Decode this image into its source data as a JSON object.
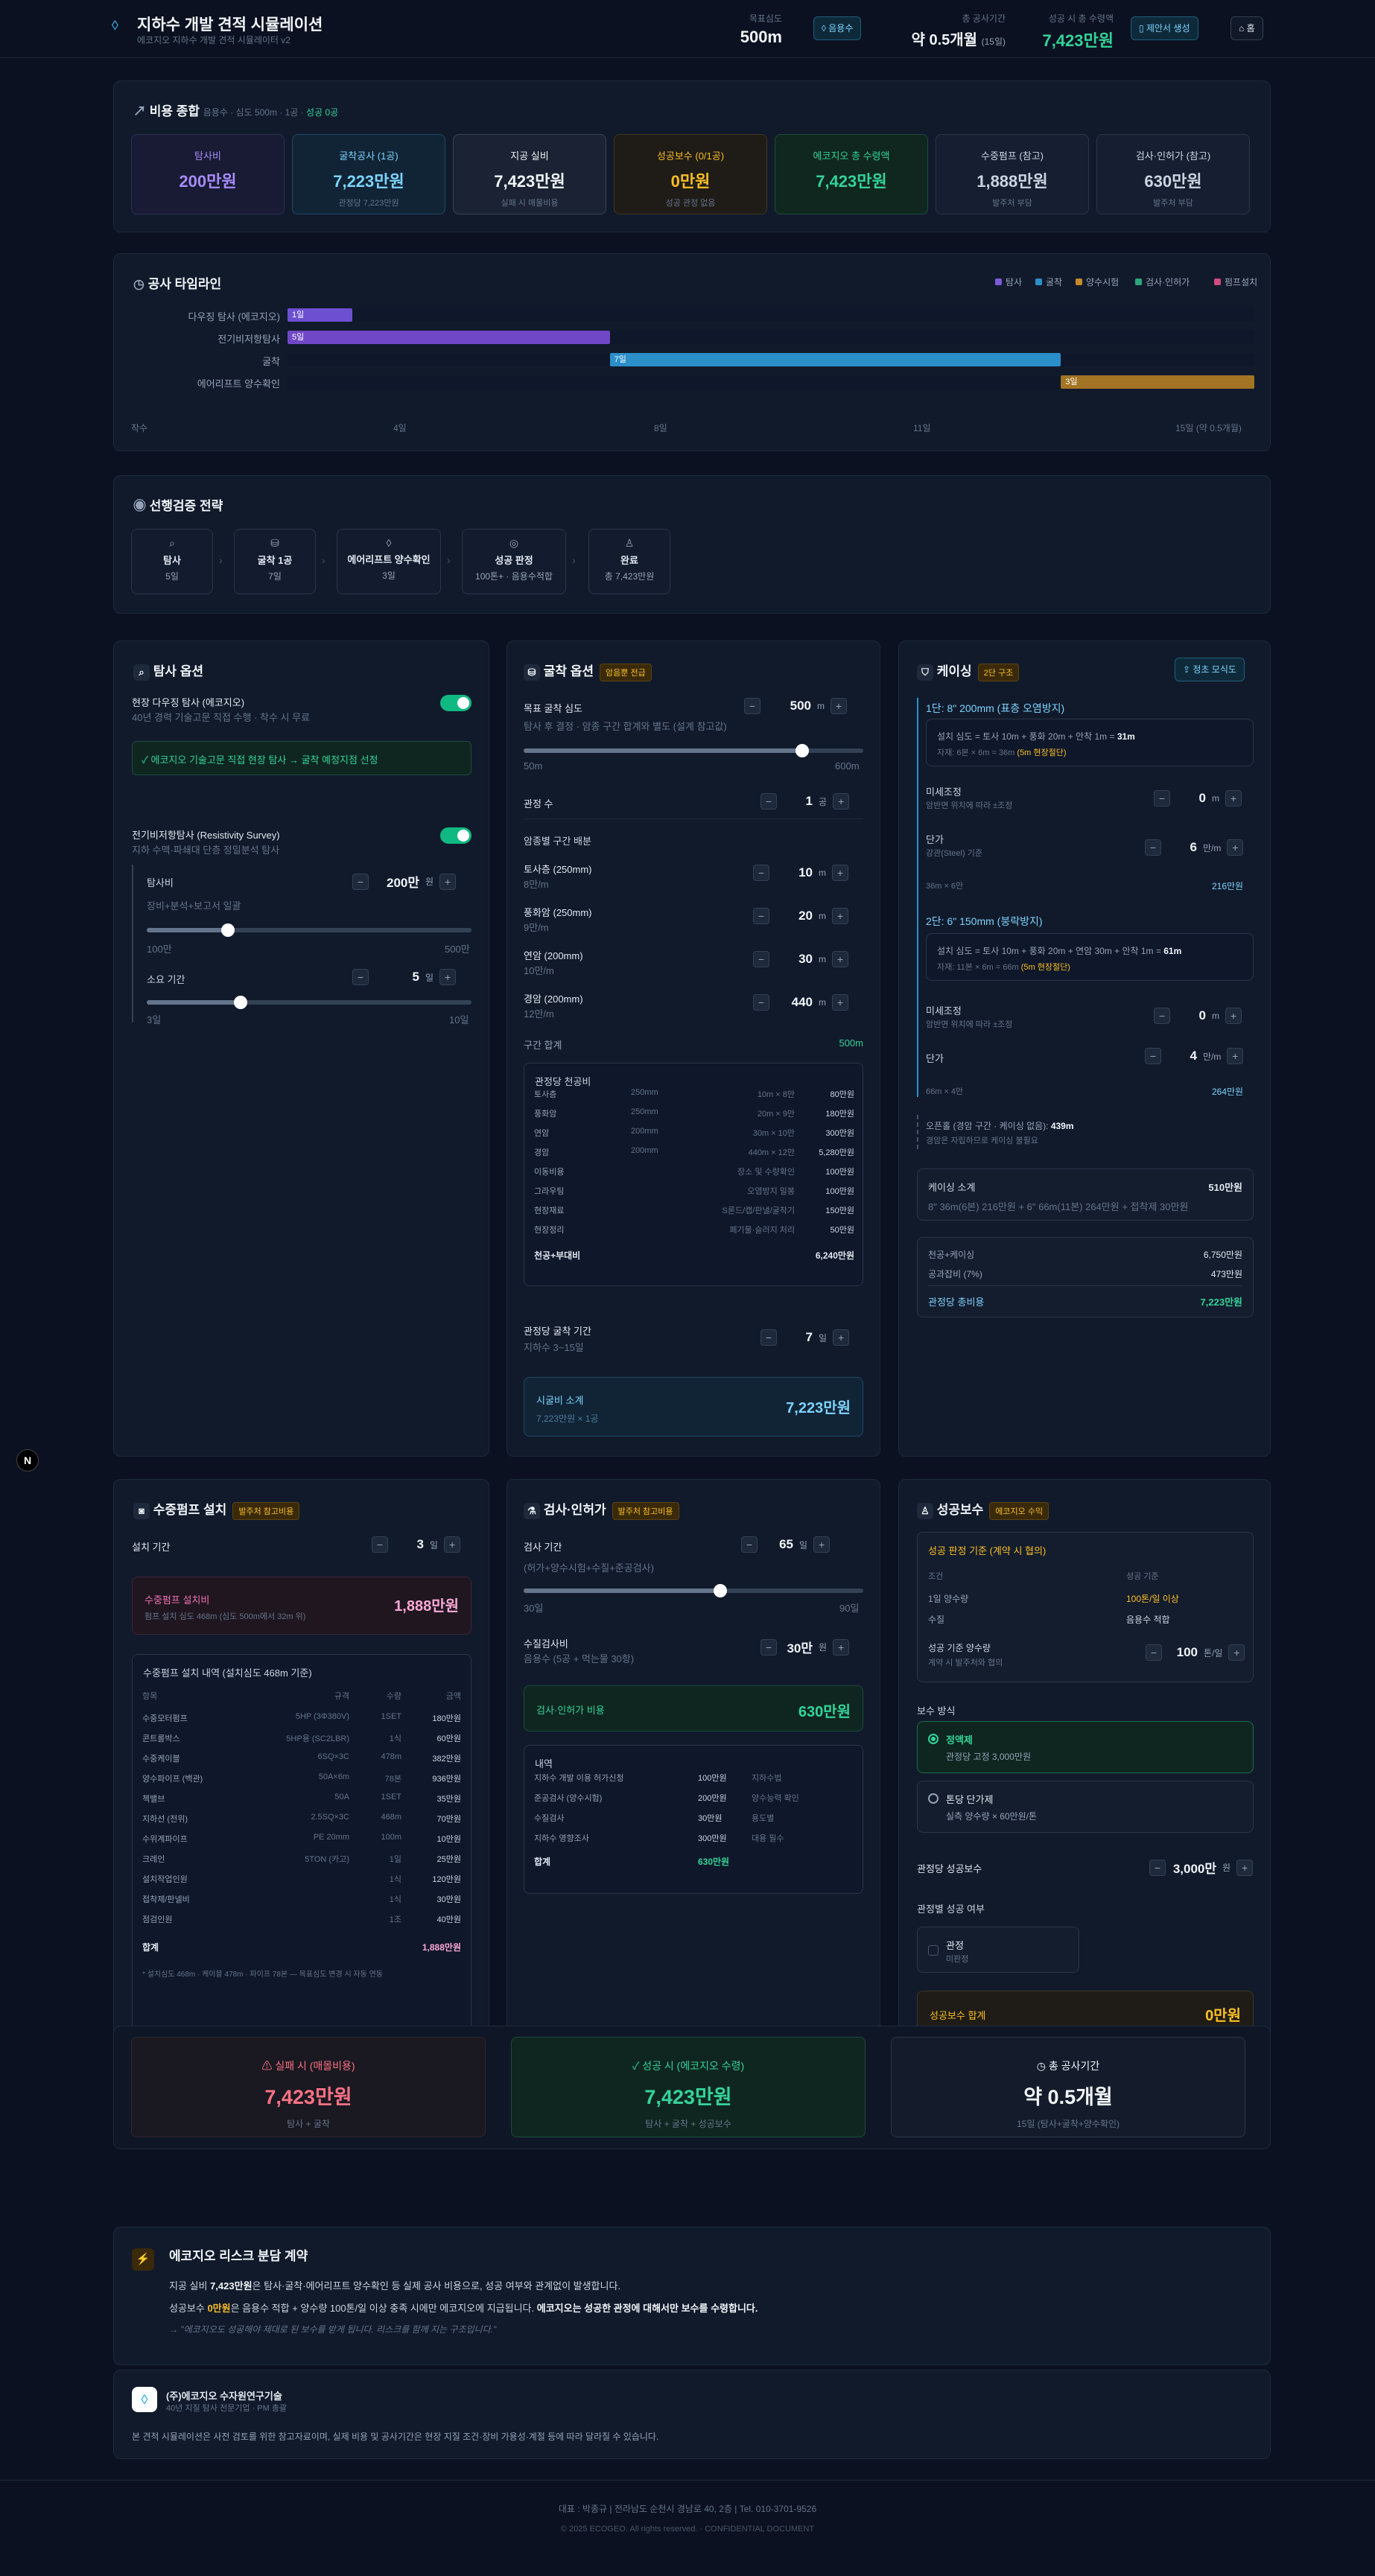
{
  "header": {
    "title": "지하수 개발 견적 시뮬레이션",
    "subtitle": "에코지오 지하수 개발 견적 시뮬레이터 v2",
    "stats": [
      {
        "label": "목표심도",
        "value": "500m"
      },
      {
        "label": "총 공사기간",
        "value": "약 0.5개월",
        "extra": "(15일)"
      },
      {
        "label": "성공 시 총 수령액",
        "value": "7,423만원"
      }
    ],
    "btn_use": "음용수",
    "btn_pdf": "제안서 생성",
    "btn_home": "홈"
  },
  "summary": {
    "title": "비용 종합",
    "meta": "음용수 · 심도 500m · 1공 · ",
    "meta_status": "성공 0공",
    "boxes": [
      {
        "label": "탐사비",
        "value": "200만원",
        "sub": "",
        "color": "#a78bfa",
        "bg": "#181b33",
        "bd": "#2c2f55"
      },
      {
        "label": "굴착공사 (1공)",
        "value": "7,223만원",
        "sub": "관정당 7,223만원",
        "color": "#7dd3fc",
        "bg": "#112436",
        "bd": "#1f4766"
      },
      {
        "label": "지공 실비",
        "value": "7,423만원",
        "sub": "실패 시 매몰비용",
        "color": "#f1f5f9",
        "bg": "#1a2233",
        "bd": "#384357"
      },
      {
        "label": "성공보수 (0/1공)",
        "value": "0만원",
        "sub": "성공 관정 없음",
        "color": "#fbbf24",
        "bg": "#1f1c17",
        "bd": "#3f3520"
      },
      {
        "label": "에코지오 총 수령액",
        "value": "7,423만원",
        "sub": "",
        "color": "#34d399",
        "bg": "#10271f",
        "bd": "#1c4a3a"
      },
      {
        "label": "수중펌프 (참고)",
        "value": "1,888만원",
        "sub": "발주처 부담",
        "color": "#cbd5e1",
        "bg": "#161f31",
        "bd": "#2a3548"
      },
      {
        "label": "검사·인허가 (참고)",
        "value": "630만원",
        "sub": "발주처 부담",
        "color": "#cbd5e1",
        "bg": "#161f31",
        "bd": "#2a3548"
      }
    ]
  },
  "timeline": {
    "title": "공사 타임라인",
    "legend": [
      {
        "name": "탐사",
        "color": "#7c5bd6"
      },
      {
        "name": "굴착",
        "color": "#2b8fc9"
      },
      {
        "name": "양수시험",
        "color": "#c78a2a"
      },
      {
        "name": "검사·인허가",
        "color": "#2fa57c"
      },
      {
        "name": "펌프설치",
        "color": "#d14b7d"
      }
    ],
    "rows": [
      {
        "label": "다우징 탐사 (에코지오)",
        "text": "1일",
        "start": 0,
        "dur": 1,
        "color": "#6d4fd1"
      },
      {
        "label": "전기비저항탐사",
        "text": "5일",
        "start": 0,
        "dur": 5,
        "color": "#7048c7"
      },
      {
        "label": "굴착",
        "text": "7일",
        "start": 5,
        "dur": 7,
        "color": "#2b8fc9"
      },
      {
        "label": "에어리프트 양수확인",
        "text": "3일",
        "start": 12,
        "dur": 3,
        "color": "#a27424"
      }
    ],
    "total_days": 15,
    "ticks": [
      "착수",
      "4일",
      "8일",
      "11일",
      "15일 (약 0.5개월)"
    ]
  },
  "strategy": {
    "title": "선행검증 전략",
    "steps": [
      {
        "icon": "⌕",
        "name": "탐사",
        "desc": "5일"
      },
      {
        "icon": "⛁",
        "name": "굴착 1공",
        "desc": "7일"
      },
      {
        "icon": "◊",
        "name": "에어리프트 양수확인",
        "desc": "3일"
      },
      {
        "icon": "◎",
        "name": "성공 판정",
        "desc": "100톤+ · 음용수적합"
      },
      {
        "icon": "♙",
        "name": "완료",
        "desc": "총 7,423만원"
      }
    ]
  },
  "explore": {
    "title": "탐사 옵션",
    "dowsing_title": "현장 다우징 탐사 (에코지오)",
    "dowsing_desc": "40년 경력 기술고문 직접 수행 · 착수 시 무료",
    "dowsing_note": "✓ 에코지오 기술고문 직접 현장 탐사 → 굴착 예정지점 선정",
    "resist_title": "전기비저항탐사 (Resistivity Survey)",
    "resist_desc": "지하 수맥·파쇄대 단층 정밀분석 탐사",
    "cost_label": "탐사비",
    "cost_value": "200만",
    "cost_unit": "원",
    "cost_hint": "장비+분석+보고서 일괄",
    "cost_min": "100만",
    "cost_max": "500만",
    "cost_frac": 0.25,
    "dur_label": "소요 기간",
    "dur_value": "5",
    "dur_unit": "일",
    "dur_min": "3일",
    "dur_max": "10일",
    "dur_frac": 0.29
  },
  "drill": {
    "title": "굴착 옵션",
    "badge": "암음뿐 전급",
    "depth_label": "목표 굴착 심도",
    "depth_value": "500",
    "depth_unit": "m",
    "depth_hint": "탐사 후 결정 · 암종 구간 합계와 별도 (설계 참고값)",
    "depth_min": "50m",
    "depth_max": "600m",
    "depth_frac": 0.82,
    "count_label": "관정 수",
    "count_value": "1",
    "count_unit": "공",
    "layers_title": "암종별 구간 배분",
    "layers": [
      {
        "name": "토사층 (250mm)",
        "sub": "8만/m",
        "value": "10",
        "unit": "m"
      },
      {
        "name": "풍화암 (250mm)",
        "sub": "9만/m",
        "value": "20",
        "unit": "m"
      },
      {
        "name": "연암 (200mm)",
        "sub": "10만/m",
        "value": "30",
        "unit": "m"
      },
      {
        "name": "경암 (200mm)",
        "sub": "12만/m",
        "value": "440",
        "unit": "m"
      }
    ],
    "sum_label": "구간 합계",
    "sum_value": "500m",
    "cost_title": "관정당 천공비",
    "cost_rows": [
      [
        "토사층",
        "250mm",
        "10m × 8만",
        "80만원"
      ],
      [
        "풍화암",
        "250mm",
        "20m × 9만",
        "180만원"
      ],
      [
        "연암",
        "200mm",
        "30m × 10만",
        "300만원"
      ],
      [
        "경암",
        "200mm",
        "440m × 12만",
        "5,280만원"
      ],
      [
        "이동비용",
        "",
        "장소 및 수량확인",
        "100만원"
      ],
      [
        "그라우팅",
        "",
        "오염방지 밀봉",
        "100만원"
      ],
      [
        "현장재료",
        "",
        "S론드/캡/판낼/굴착기",
        "150만원"
      ],
      [
        "현장정리",
        "",
        "폐기물·슬러지 처리",
        "50만원"
      ]
    ],
    "cost_total_label": "천공+부대비",
    "cost_total_value": "6,240만원",
    "period_label": "관정당 굴착 기간",
    "period_hint": "지하수 3~15일",
    "period_value": "7",
    "period_unit": "일",
    "subtotal_label": "시굴비 소계",
    "subtotal_sub": "7,223만원 × 1공",
    "subtotal_value": "7,223만원"
  },
  "casing": {
    "title": "케이싱",
    "badge": "2단 구조",
    "btn": "정초 모식도",
    "s1_title": "1단: 8\" 200mm (표층 오염방지)",
    "s1_calc": "설치 심도 = 토사 10m + 풍화 20m + 안착 1m = ",
    "s1_calc_v": "31m",
    "s1_calc2": "자재: 6본 × 6m = 36m ",
    "s1_calc2_v": "(5m 현장절단)",
    "s1_adj_label": "미세조정",
    "s1_adj_hint": "암반면 위치에 따라 ±조정",
    "s1_adj_value": "0",
    "s1_adj_unit": "m",
    "s1_price_label": "단가",
    "s1_price_hint": "강관(Steel) 기준",
    "s1_price_value": "6",
    "s1_price_unit": "만/m",
    "s1_foot": "36m × 6만",
    "s1_foot_v": "216만원",
    "s2_title": "2단: 6\" 150mm (붕락방지)",
    "s2_calc": "설치 심도 = 토사 10m + 풍화 20m + 연암 30m + 안착 1m = ",
    "s2_calc_v": "61m",
    "s2_calc2": "자재: 11본 × 6m = 66m ",
    "s2_calc2_v": "(5m 현장절단)",
    "s2_adj_label": "미세조정",
    "s2_adj_hint": "암반면 위치에 따라 ±조정",
    "s2_adj_value": "0",
    "s2_adj_unit": "m",
    "s2_price_label": "단가",
    "s2_price_value": "4",
    "s2_price_unit": "만/m",
    "s2_foot": "66m × 4만",
    "s2_foot_v": "264만원",
    "open_label": "오픈홀 (경암 구간 · 케이싱 없음):",
    "open_value": "439m",
    "open_hint": "경암은 자립하므로 케이싱 불필요",
    "sub_label": "케이싱 소계",
    "sub_value": "510만원",
    "sub_detail": "8\" 36m(6본) 216만원 + 6\" 66m(11본) 264만원 + 접착제 30만원",
    "totals": [
      [
        "천공+케이싱",
        "6,750만원"
      ],
      [
        "공과잡비 (7%)",
        "473만원"
      ]
    ],
    "final_label": "관정당 총비용",
    "final_value": "7,223만원"
  },
  "pump": {
    "title": "수중펌프 설치",
    "badge": "발주처 참고비용",
    "period_label": "설치 기간",
    "period_value": "3",
    "period_unit": "일",
    "cost_label": "수중펌프 설치비",
    "cost_hint": "펌프 설치 심도 468m (심도 500m에서 32m 위)",
    "cost_value": "1,888만원",
    "table_title": "수중펌프 설치 내역 (설치심도 468m 기준)",
    "cols": [
      "항목",
      "규격",
      "수량",
      "금액"
    ],
    "rows": [
      [
        "수중모터펌프",
        "5HP (3Φ380V)",
        "1SET",
        "180만원"
      ],
      [
        "콘트롤박스",
        "5HP용 (SC2LBR)",
        "1식",
        "60만원"
      ],
      [
        "수중케이블",
        "6SQ×3C",
        "478m",
        "382만원"
      ],
      [
        "양수파이프 (백관)",
        "50A×6m",
        "78본",
        "936만원"
      ],
      [
        "첵밸브",
        "50A",
        "1SET",
        "35만원"
      ],
      [
        "지하선 (전위)",
        "2.5SQ×3C",
        "468m",
        "70만원"
      ],
      [
        "수위계파이프",
        "PE 20mm",
        "100m",
        "10만원"
      ],
      [
        "크레인",
        "5TON (카고)",
        "1일",
        "25만원"
      ],
      [
        "설치작업인원",
        "",
        "1식",
        "120만원"
      ],
      [
        "접착제/판넬비",
        "",
        "1식",
        "30만원"
      ],
      [
        "점검인원",
        "",
        "1조",
        "40만원"
      ]
    ],
    "total_label": "합계",
    "total_value": "1,888만원",
    "note": "* 설치심도 468m · 케이블 478m · 파이프 78본 — 목표심도 변경 시 자동 연동"
  },
  "inspect": {
    "title": "검사·인허가",
    "badge": "발주처 참고비용",
    "period_label": "검사 기간",
    "period_value": "65",
    "period_unit": "일",
    "period_hint": "(허가+양수시험+수질+준공검사)",
    "period_min": "30일",
    "period_max": "90일",
    "period_frac": 0.58,
    "water_label": "수질검사비",
    "water_hint": "음용수 (5공 + 먹는물 30항)",
    "water_value": "30만",
    "water_unit": "원",
    "cost_label": "검사·인허가 비용",
    "cost_value": "630만원",
    "table_title": "내역",
    "rows": [
      [
        "지하수 개발 이용 허가신청",
        "100만원",
        "지하수법"
      ],
      [
        "준공검사 (양수시험)",
        "200만원",
        "양수능력 확인"
      ],
      [
        "수질검사",
        "30만원",
        "용도별"
      ],
      [
        "지하수 영향조사",
        "300만원",
        "대용 필수"
      ]
    ],
    "total_label": "합계",
    "total_value": "630만원"
  },
  "fee": {
    "title": "성공보수",
    "badge": "에코지오 수익",
    "crit_title": "성공 판정 기준 (계약 시 협의)",
    "crit_cols": [
      "조건",
      "성공 기준"
    ],
    "crit_rows": [
      [
        "1일 양수량",
        "100톤/일 이상"
      ],
      [
        "수질",
        "음용수 적합"
      ]
    ],
    "min_label": "성공 기준 양수량",
    "min_hint": "계약 시 발주처와 협의",
    "min_value": "100",
    "min_unit": "톤/일",
    "method_label": "보수 방식",
    "m1_name": "정액제",
    "m1_desc": "관정당 고정 3,000만원",
    "m2_name": "톤당 단가제",
    "m2_desc": "실측 양수량 × 60만원/톤",
    "amount_label": "관정당 성공보수",
    "amount_value": "3,000만",
    "amount_unit": "원",
    "per_label": "관정별 성공 여부",
    "well_name": "관정",
    "well_status": "미판정",
    "total_label": "성공보수 합계",
    "total_value": "0만원"
  },
  "bottom": [
    {
      "label": "실패 시 (매몰비용)",
      "value": "7,423만원",
      "sub": "탐사 + 굴착",
      "color": "#fb7185",
      "bg": "#1a1820",
      "bd": "#2e2630",
      "icon": "⚠"
    },
    {
      "label": "성공 시 (에코지오 수령)",
      "value": "7,423만원",
      "sub": "탐사 + 굴착 + 성공보수",
      "color": "#34d399",
      "bg": "#0f2620",
      "bd": "#1c4a3a",
      "icon": "✓"
    },
    {
      "label": "총 공사기간",
      "value": "약 0.5개월",
      "sub": "15일 (탐사+굴착+양수확인)",
      "color": "#f1f5f9",
      "bg": "#141c2c",
      "bd": "#2a3548",
      "icon": "◷"
    }
  ],
  "risk": {
    "title": "에코지오 리스크 분담 계약",
    "l1a": "지공 실비 ",
    "l1b": "7,423만원",
    "l1c": "은 탐사·굴착·에어리프트 양수확인 등 실제 공사 비용으로, 성공 여부와 관계없이 발생합니다.",
    "l2a": "성공보수 ",
    "l2b": "0만원",
    "l2c": "은 음용수 적합 + 양수량 100톤/일 이상 충족 시에만 에코지오에 지급됩니다. ",
    "l2d": "에코지오는 성공한 관정에 대해서만 보수를 수령합니다.",
    "l3": "→ \"에코지오도 성공해야 제대로 된 보수를 받게 됩니다. 리스크를 함께 지는 구조입니다.\""
  },
  "company": {
    "name": "(주)에코지오 수자원연구기술",
    "desc": "40년 지질 탐사 전문기업 · PM 총괄",
    "note": "본 견적 시뮬레이션은 사전 검토를 위한 참고자료이며, 실제 비용 및 공사기간은 현장 지질 조건·장비 가용성·계절 등에 따라 달라질 수 있습니다."
  },
  "footer": {
    "line1": "대표 : 박종규  |  전라남도 순천시 경남로 40, 2층  |  Tel. 010-3701-9526",
    "line2": "© 2025 ECOGEO. All rights reserved. · CONFIDENTIAL DOCUMENT"
  },
  "colors": {
    "accent": "#38bdf8",
    "success": "#34d399",
    "warn": "#fbbf24"
  }
}
